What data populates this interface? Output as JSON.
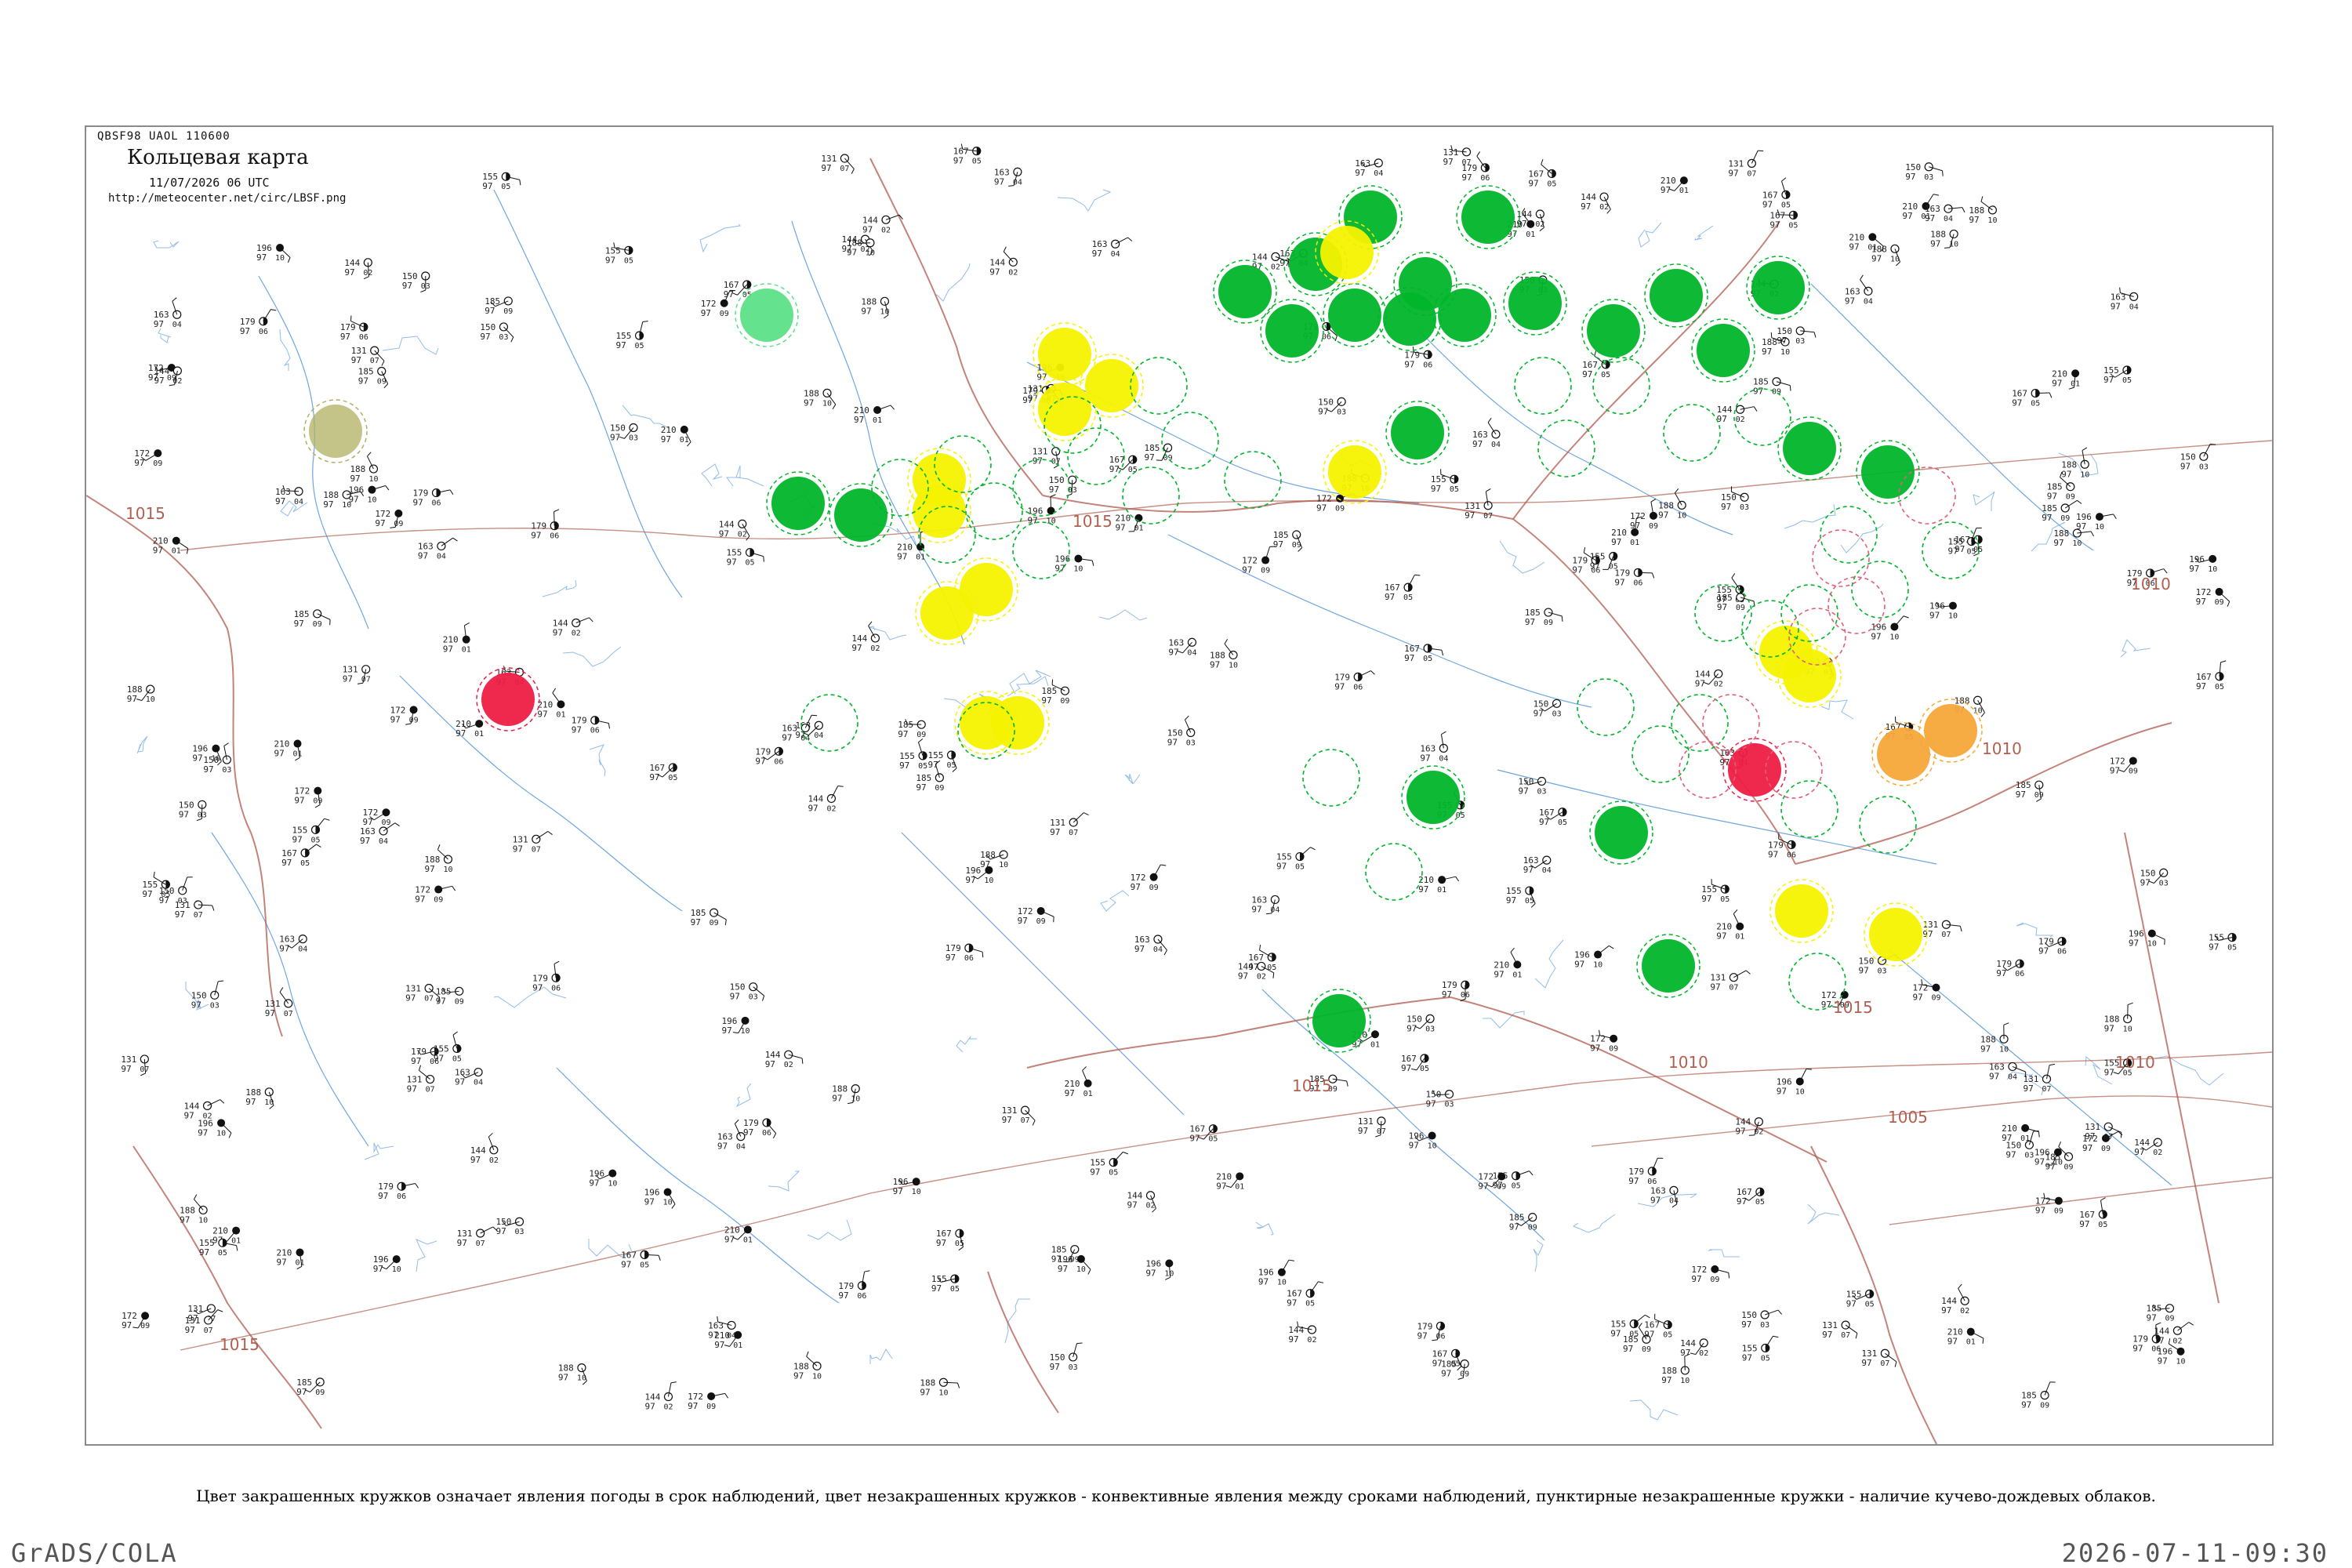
{
  "header": {
    "code": "QBSF98  UAOL  110600",
    "title": "Кольцевая карта",
    "datetime": "11/07/2026 06 UTC",
    "url": "http://meteocenter.net/circ/LBSF.png"
  },
  "caption": "Цвет закрашенных кружков означает явления погоды в срок наблюдений, цвет незакрашенных кружков - конвективные явления между сроками наблюдений, пунктирные незакрашенные кружки - наличие кучево-дождевых облаков.",
  "footer": {
    "left": "GrADS/COLA",
    "right": "2026-07-11-09:30"
  },
  "colors": {
    "green": "#00b52a",
    "light_green": "#5de087",
    "yellow": "#f6f200",
    "pale_yellow": "#f4f07a",
    "orange": "#f5a838",
    "red": "#ee1c44",
    "olive": "#b0b060",
    "pink": "#e0607a",
    "water": "#4a90d9",
    "border": "#b05a4e",
    "isobar": "#b06050"
  },
  "isobar_labels": [
    "1010",
    "1015",
    "1015",
    "1015",
    "1010",
    "1010",
    "1015",
    "1010",
    "1005",
    "1015"
  ],
  "station_samples": [
    {
      "t": "172",
      "p": "97",
      "v": "09"
    },
    {
      "t": "188",
      "p": "97",
      "v": "10"
    },
    {
      "t": "155",
      "p": "97",
      "v": "05"
    },
    {
      "t": "163",
      "p": "97",
      "v": "04"
    },
    {
      "t": "210",
      "p": "97",
      "v": "01"
    },
    {
      "t": "150",
      "p": "97",
      "v": "03"
    },
    {
      "t": "179",
      "p": "97",
      "v": "06"
    },
    {
      "t": "144",
      "p": "97",
      "v": "02"
    },
    {
      "t": "196",
      "p": "97",
      "v": "10"
    },
    {
      "t": "131",
      "p": "97",
      "v": "07"
    },
    {
      "t": "167",
      "p": "97",
      "v": "05"
    },
    {
      "t": "185",
      "p": "97",
      "v": "09"
    }
  ]
}
